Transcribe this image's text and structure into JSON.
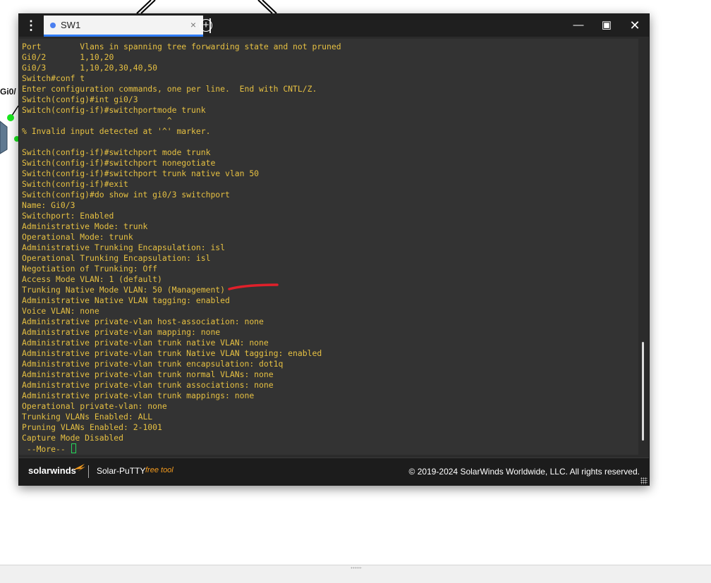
{
  "background": {
    "port_label": "Gi0/"
  },
  "window": {
    "tab_title": "SW1",
    "tab_close": "×",
    "new_tab": "+",
    "minimize": "—",
    "maximize": "▣",
    "close": "✕",
    "menu": "⋮"
  },
  "terminal": {
    "lines": [
      "Port        Vlans in spanning tree forwarding state and not pruned",
      "Gi0/2       1,10,20",
      "Gi0/3       1,10,20,30,40,50",
      "Switch#conf t",
      "Enter configuration commands, one per line.  End with CNTL/Z.",
      "Switch(config)#int gi0/3",
      "Switch(config-if)#switchportmode trunk",
      "                              ^",
      "% Invalid input detected at '^' marker.",
      "",
      "Switch(config-if)#switchport mode trunk",
      "Switch(config-if)#switchport nonegotiate",
      "Switch(config-if)#switchport trunk native vlan 50",
      "Switch(config-if)#exit",
      "Switch(config)#do show int gi0/3 switchport",
      "Name: Gi0/3",
      "Switchport: Enabled",
      "Administrative Mode: trunk",
      "Operational Mode: trunk",
      "Administrative Trunking Encapsulation: isl",
      "Operational Trunking Encapsulation: isl",
      "Negotiation of Trunking: Off",
      "Access Mode VLAN: 1 (default)",
      "Trunking Native Mode VLAN: 50 (Management)",
      "Administrative Native VLAN tagging: enabled",
      "Voice VLAN: none",
      "Administrative private-vlan host-association: none",
      "Administrative private-vlan mapping: none",
      "Administrative private-vlan trunk native VLAN: none",
      "Administrative private-vlan trunk Native VLAN tagging: enabled",
      "Administrative private-vlan trunk encapsulation: dot1q",
      "Administrative private-vlan trunk normal VLANs: none",
      "Administrative private-vlan trunk associations: none",
      "Administrative private-vlan trunk mappings: none",
      "Operational private-vlan: none",
      "Trunking VLANs Enabled: ALL",
      "Pruning VLANs Enabled: 2-1001",
      "Capture Mode Disabled",
      " --More-- "
    ],
    "text_color": "#e6c042",
    "bg_color": "#333333",
    "cursor_color": "#25d85a"
  },
  "footer": {
    "logo": "solarwinds",
    "product": "Solar-PuTTY",
    "free_tool": "free tool",
    "copyright": "© 2019-2024 SolarWinds Worldwide, LLC. All rights reserved."
  },
  "colors": {
    "accent": "#2f7cf6",
    "brand_orange": "#f39a1e",
    "annotation_red": "#e0202a"
  }
}
